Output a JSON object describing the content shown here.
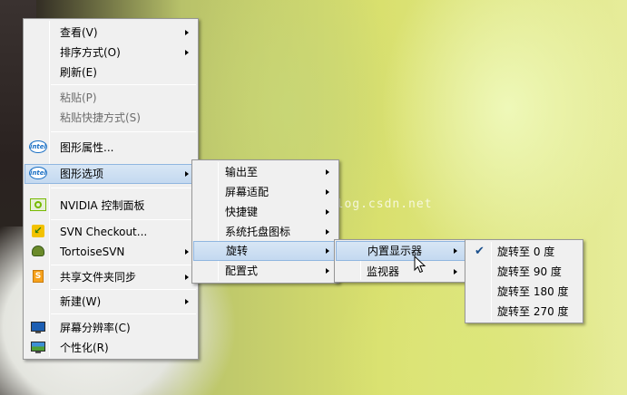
{
  "watermark": "http://blog.csdn.net",
  "context_menu": {
    "items": [
      {
        "label": "查看(V)"
      },
      {
        "label": "排序方式(O)"
      },
      {
        "label": "刷新(E)"
      },
      {
        "label": "粘贴(P)"
      },
      {
        "label": "粘贴快捷方式(S)"
      },
      {
        "label": "图形属性..."
      },
      {
        "label": "图形选项"
      },
      {
        "label": "NVIDIA 控制面板"
      },
      {
        "label": "SVN Checkout..."
      },
      {
        "label": "TortoiseSVN"
      },
      {
        "label": "共享文件夹同步"
      },
      {
        "label": "新建(W)"
      },
      {
        "label": "屏幕分辨率(C)"
      },
      {
        "label": "个性化(R)"
      }
    ]
  },
  "graphics_options_menu": {
    "items": [
      {
        "label": "输出至"
      },
      {
        "label": "屏幕适配"
      },
      {
        "label": "快捷键"
      },
      {
        "label": "系统托盘图标"
      },
      {
        "label": "旋转"
      },
      {
        "label": "配置式"
      }
    ]
  },
  "rotation_menu": {
    "items": [
      {
        "label": "内置显示器"
      },
      {
        "label": "监视器"
      }
    ]
  },
  "builtin_display_menu": {
    "checked_index": 0,
    "items": [
      {
        "label": "旋转至 0 度"
      },
      {
        "label": "旋转至 90 度"
      },
      {
        "label": "旋转至 180 度"
      },
      {
        "label": "旋转至 270 度"
      }
    ]
  },
  "icons": {
    "intel": "intel",
    "check": "✔"
  }
}
